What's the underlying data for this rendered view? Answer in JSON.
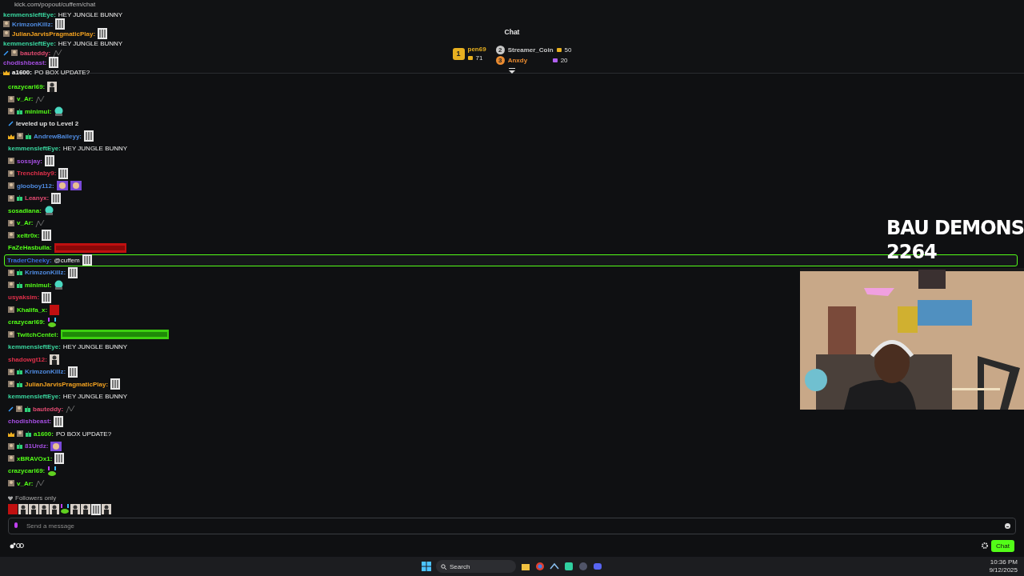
{
  "window": {
    "address": "kick.com/popout/cuffem/chat"
  },
  "background_chat": [
    {
      "name": "kemmensleftEye:",
      "color": "#3ad7a0",
      "text": "HEY JUNGLE BUNNY"
    },
    {
      "name": "KrimzonKillz:",
      "color": "#4f8be0",
      "badges": [
        {
          "kind": "avatar"
        }
      ],
      "emotes": [
        {
          "kind": "bau"
        }
      ]
    },
    {
      "name": "JulianJarvisPragmaticPlay:",
      "color": "#f0a020",
      "badges": [
        {
          "kind": "avatar"
        }
      ],
      "emotes": [
        {
          "kind": "bau"
        }
      ]
    },
    {
      "name": "kemmensleftEye:",
      "color": "#3ad7a0",
      "text": "HEY JUNGLE BUNNY"
    },
    {
      "name": "bauteddy:",
      "color": "#e04a70",
      "badges": [
        {
          "kind": "mod"
        },
        {
          "kind": "avatar"
        }
      ],
      "emotes": [
        {
          "kind": "sketch"
        }
      ]
    },
    {
      "name": "chodishbeast:",
      "color": "#a44ee0",
      "emotes": [
        {
          "kind": "bau"
        }
      ]
    },
    {
      "name": "a1600:",
      "color": "#ffffff",
      "text": "PO BOX UPDATE?",
      "badges": [
        {
          "kind": "crown"
        }
      ]
    }
  ],
  "header": {
    "title": "Chat"
  },
  "leaderboard": [
    {
      "rank": "1",
      "name": "pen69",
      "amount": "71",
      "color": "#e8b020"
    },
    {
      "rank": "2",
      "name": "Streamer_Coin",
      "amount": "50",
      "color": "#c8c8c8"
    },
    {
      "rank": "3",
      "name": "Anxdy",
      "amount": "20",
      "color": "#e88a30"
    }
  ],
  "messages": [
    {
      "kind": "chat",
      "name": "crazycarl69:",
      "color": "#53fc18",
      "emotes": [
        {
          "kind": "person"
        }
      ],
      "highlighted": false
    },
    {
      "kind": "chat",
      "name": "v_Ar:",
      "color": "#53fc18",
      "badges": [
        {
          "kind": "avatar"
        }
      ],
      "emotes": [
        {
          "kind": "sketch"
        }
      ],
      "highlighted": false
    },
    {
      "kind": "chat",
      "name": "minimul:",
      "color": "#53fc18",
      "badges": [
        {
          "kind": "avatar"
        },
        {
          "kind": "sub"
        }
      ],
      "emotes": [
        {
          "kind": "ghost"
        }
      ],
      "highlighted": false
    },
    {
      "kind": "system",
      "text": "leveled up to Level 2",
      "color": "#e0e0e0",
      "badges": [
        {
          "kind": "mod"
        }
      ],
      "highlighted": false
    },
    {
      "kind": "chat",
      "name": "AndrewBaileyy:",
      "color": "#4f8be0",
      "badges": [
        {
          "kind": "crown"
        },
        {
          "kind": "avatar"
        },
        {
          "kind": "sub"
        }
      ],
      "emotes": [
        {
          "kind": "bau"
        }
      ],
      "highlighted": false
    },
    {
      "kind": "chat",
      "name": "kemmensleftEye:",
      "color": "#3ad7a0",
      "text": "HEY JUNGLE BUNNY",
      "highlighted": false
    },
    {
      "kind": "chat",
      "name": "sossjay:",
      "color": "#a44ee0",
      "badges": [
        {
          "kind": "avatar"
        }
      ],
      "emotes": [
        {
          "kind": "bau"
        }
      ],
      "highlighted": false
    },
    {
      "kind": "chat",
      "name": "Trenchlaby9:",
      "color": "#e0304a",
      "badges": [
        {
          "kind": "avatar"
        }
      ],
      "emotes": [
        {
          "kind": "bau"
        }
      ],
      "highlighted": false
    },
    {
      "kind": "chat",
      "name": "glooboy112:",
      "color": "#4f8be0",
      "badges": [
        {
          "kind": "avatar"
        }
      ],
      "emotes": [
        {
          "kind": "monkey"
        },
        {
          "kind": "monkey"
        }
      ],
      "highlighted": false
    },
    {
      "kind": "chat",
      "name": "Leanyx:",
      "color": "#e04a70",
      "badges": [
        {
          "kind": "avatar"
        },
        {
          "kind": "sub"
        }
      ],
      "emotes": [
        {
          "kind": "bau"
        }
      ],
      "highlighted": false
    },
    {
      "kind": "chat",
      "name": "sosadiana:",
      "color": "#53fc18",
      "emotes": [
        {
          "kind": "ghost"
        }
      ],
      "highlighted": false
    },
    {
      "kind": "chat",
      "name": "v_Ar:",
      "color": "#53fc18",
      "badges": [
        {
          "kind": "avatar"
        }
      ],
      "emotes": [
        {
          "kind": "sketch"
        }
      ],
      "highlighted": false
    },
    {
      "kind": "chat",
      "name": "xeltr0x:",
      "color": "#53fc18",
      "badges": [
        {
          "kind": "avatar"
        }
      ],
      "emotes": [
        {
          "kind": "bau"
        }
      ],
      "highlighted": false
    },
    {
      "kind": "chat",
      "name": "FaZeHasbulla:",
      "color": "#53fc18",
      "emotes": [
        {
          "kind": "red-banner"
        }
      ],
      "highlighted": false
    },
    {
      "kind": "chat",
      "name": "TraderCheeky:",
      "color": "#3a6ee0",
      "text": "@cuffem",
      "emotes": [
        {
          "kind": "bau"
        }
      ],
      "highlighted": true
    },
    {
      "kind": "chat",
      "name": "KrimzonKillz:",
      "color": "#4f8be0",
      "badges": [
        {
          "kind": "avatar"
        },
        {
          "kind": "sub"
        }
      ],
      "emotes": [
        {
          "kind": "bau"
        }
      ],
      "highlighted": false
    },
    {
      "kind": "chat",
      "name": "minimul:",
      "color": "#53fc18",
      "badges": [
        {
          "kind": "avatar"
        },
        {
          "kind": "sub"
        }
      ],
      "emotes": [
        {
          "kind": "ghost"
        }
      ],
      "highlighted": false
    },
    {
      "kind": "chat",
      "name": "usyaksim:",
      "color": "#e0304a",
      "emotes": [
        {
          "kind": "bau"
        }
      ],
      "highlighted": false
    },
    {
      "kind": "chat",
      "name": "Khalifa_x:",
      "color": "#53fc18",
      "badges": [
        {
          "kind": "avatar"
        }
      ],
      "emotes": [
        {
          "kind": "red"
        }
      ],
      "highlighted": false
    },
    {
      "kind": "chat",
      "name": "crazycarl69:",
      "color": "#53fc18",
      "emotes": [
        {
          "kind": "frog"
        }
      ],
      "highlighted": false
    },
    {
      "kind": "chat",
      "name": "TwitchCentel:",
      "color": "#53fc18",
      "badges": [
        {
          "kind": "avatar"
        }
      ],
      "emotes": [
        {
          "kind": "green-banner"
        }
      ],
      "highlighted": false
    },
    {
      "kind": "chat",
      "name": "kemmensleftEye:",
      "color": "#3ad7a0",
      "text": "HEY JUNGLE BUNNY",
      "highlighted": false
    },
    {
      "kind": "chat",
      "name": "shadowgt12:",
      "color": "#e0304a",
      "emotes": [
        {
          "kind": "person"
        }
      ],
      "highlighted": false
    },
    {
      "kind": "chat",
      "name": "KrimzonKillz:",
      "color": "#4f8be0",
      "badges": [
        {
          "kind": "avatar"
        },
        {
          "kind": "sub"
        }
      ],
      "emotes": [
        {
          "kind": "bau"
        }
      ],
      "highlighted": false
    },
    {
      "kind": "chat",
      "name": "JulianJarvisPragmaticPlay:",
      "color": "#f0a020",
      "badges": [
        {
          "kind": "avatar"
        },
        {
          "kind": "sub"
        }
      ],
      "emotes": [
        {
          "kind": "bau"
        }
      ],
      "highlighted": false
    },
    {
      "kind": "chat",
      "name": "kemmensleftEye:",
      "color": "#3ad7a0",
      "text": "HEY JUNGLE BUNNY",
      "highlighted": false
    },
    {
      "kind": "chat",
      "name": "bauteddy:",
      "color": "#e04a70",
      "badges": [
        {
          "kind": "mod"
        },
        {
          "kind": "avatar"
        },
        {
          "kind": "sub"
        }
      ],
      "emotes": [
        {
          "kind": "sketch"
        }
      ],
      "highlighted": false
    },
    {
      "kind": "chat",
      "name": "chodishbeast:",
      "color": "#a44ee0",
      "emotes": [
        {
          "kind": "bau"
        }
      ],
      "highlighted": false
    },
    {
      "kind": "chat",
      "name": "a1600:",
      "color": "#53fc18",
      "text": "PO BOX UPDATE?",
      "badges": [
        {
          "kind": "crown"
        },
        {
          "kind": "avatar"
        },
        {
          "kind": "sub"
        }
      ],
      "highlighted": false
    },
    {
      "kind": "chat",
      "name": "81Urdz:",
      "color": "#a44ee0",
      "badges": [
        {
          "kind": "avatar"
        },
        {
          "kind": "sub"
        }
      ],
      "emotes": [
        {
          "kind": "monkey"
        }
      ],
      "highlighted": false
    },
    {
      "kind": "chat",
      "name": "xBRAVOx1:",
      "color": "#53fc18",
      "badges": [
        {
          "kind": "avatar"
        }
      ],
      "emotes": [
        {
          "kind": "bau"
        }
      ],
      "highlighted": false
    },
    {
      "kind": "chat",
      "name": "crazycarl69:",
      "color": "#53fc18",
      "emotes": [
        {
          "kind": "frog"
        }
      ],
      "highlighted": false
    },
    {
      "kind": "chat",
      "name": "v_Ar:",
      "color": "#53fc18",
      "badges": [
        {
          "kind": "avatar"
        }
      ],
      "emotes": [
        {
          "kind": "sketch"
        }
      ],
      "highlighted": false
    }
  ],
  "overlay": {
    "title": "BAU DEMONS",
    "count": "2264"
  },
  "chat_mode": "Followers only",
  "recent_emotes": [
    {
      "kind": "red"
    },
    {
      "kind": "person"
    },
    {
      "kind": "person"
    },
    {
      "kind": "person"
    },
    {
      "kind": "person"
    },
    {
      "kind": "frog"
    },
    {
      "kind": "person"
    },
    {
      "kind": "person"
    },
    {
      "kind": "bau"
    },
    {
      "kind": "person"
    }
  ],
  "composer": {
    "placeholder": "Send a message"
  },
  "send_button": "Chat",
  "taskbar": {
    "search": "Search",
    "time": "10:36 PM",
    "date": "9/12/2025",
    "apps": [
      {
        "kind": "folder"
      },
      {
        "kind": "browser"
      },
      {
        "kind": "steam"
      },
      {
        "kind": "app"
      },
      {
        "kind": "controller"
      },
      {
        "kind": "chat"
      }
    ]
  }
}
